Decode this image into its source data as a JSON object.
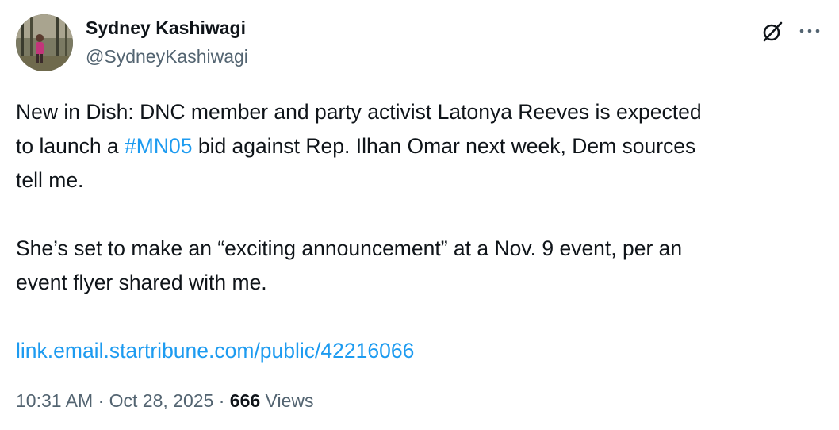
{
  "author": {
    "name": "Sydney Kashiwagi",
    "handle": "@SydneyKashiwagi"
  },
  "tweet": {
    "line1": "New in Dish: DNC member and party activist Latonya Reeves is expected",
    "line2_before": "to launch a ",
    "hashtag": "#MN05",
    "line2_after": " bid against Rep. Ilhan Omar next week, Dem sources",
    "line3": "tell me.",
    "line4": "She’s set to make an “exciting announcement” at a Nov. 9 event, per an",
    "line5": "event flyer shared with me.",
    "link": "link.email.startribune.com/public/42216066"
  },
  "meta": {
    "time": "10:31 AM",
    "separator": " · ",
    "date": "Oct 28, 2025",
    "views_count": "666",
    "views_label": " Views"
  },
  "icons": {
    "grok": "grok-icon",
    "more": "more-icon"
  },
  "colors": {
    "text": "#0f1419",
    "secondary": "#536471",
    "accent": "#1d9bf0"
  }
}
